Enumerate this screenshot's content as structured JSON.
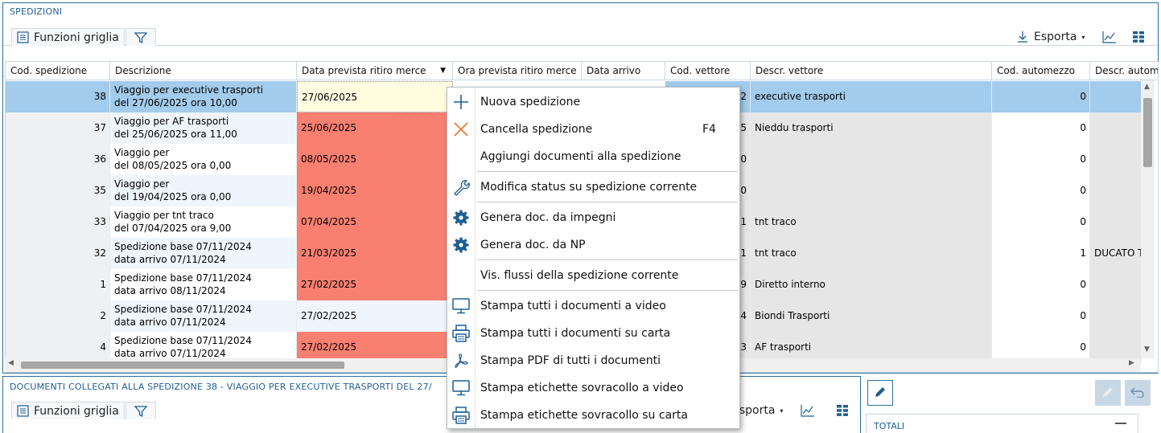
{
  "top_panel": {
    "title": "SPEDIZIONI",
    "toolbar": {
      "funzioni_griglia": "Funzioni griglia",
      "esporta": "Esporta"
    }
  },
  "grid": {
    "columns": [
      "Cod. spedizione",
      "Descrizione",
      "Data prevista ritiro merce",
      "Ora prevista ritiro merce",
      "Data arrivo",
      "Cod. vettore",
      "Descr. vettore",
      "Cod. automezzo",
      "Descr. autom"
    ],
    "rows": [
      {
        "cod": "38",
        "desc1": "Viaggio per executive trasporti",
        "desc2": "del 27/06/2025 ora 10,00",
        "data": "27/06/2025",
        "vett_cod": "2",
        "vett": "executive trasporti",
        "auto": "0",
        "auto_descr": ""
      },
      {
        "cod": "37",
        "desc1": "Viaggio per AF trasporti",
        "desc2": "del 25/06/2025 ora 11,00",
        "data": "25/06/2025",
        "vett_cod": "5",
        "vett": "Nieddu trasporti",
        "auto": "0",
        "auto_descr": ""
      },
      {
        "cod": "36",
        "desc1": "Viaggio per",
        "desc2": "del 08/05/2025 ora 0,00",
        "data": "08/05/2025",
        "vett_cod": "0",
        "vett": "",
        "auto": "0",
        "auto_descr": ""
      },
      {
        "cod": "35",
        "desc1": "Viaggio per",
        "desc2": "del 19/04/2025 ora 0,00",
        "data": "19/04/2025",
        "vett_cod": "0",
        "vett": "",
        "auto": "0",
        "auto_descr": ""
      },
      {
        "cod": "33",
        "desc1": "Viaggio per tnt traco",
        "desc2": "del 07/04/2025 ora 9,00",
        "data": "07/04/2025",
        "vett_cod": "1",
        "vett": "tnt traco",
        "auto": "0",
        "auto_descr": ""
      },
      {
        "cod": "32",
        "desc1": "Spedizione base 07/11/2024",
        "desc2": "data arrivo 07/11/2024",
        "data": "21/03/2025",
        "vett_cod": "1",
        "vett": "tnt traco",
        "auto": "1",
        "auto_descr": "DUCATO T"
      },
      {
        "cod": "1",
        "desc1": "Spedizione base 07/11/2024",
        "desc2": "data arrivo 08/11/2024",
        "data": "27/02/2025",
        "vett_cod": "9",
        "vett": "Diretto interno",
        "auto": "0",
        "auto_descr": ""
      },
      {
        "cod": "2",
        "desc1": "Spedizione base 07/11/2024",
        "desc2": "data arrivo 07/11/2024",
        "data": "27/02/2025",
        "vett_cod": "4",
        "vett": "Biondi Trasporti",
        "auto": "0",
        "auto_descr": ""
      },
      {
        "cod": "4",
        "desc1": "Spedizione base 07/11/2024",
        "desc2": "data arrivo 07/11/2024",
        "data": "27/02/2025",
        "vett_cod": "3",
        "vett": "AF trasporti",
        "auto": "0",
        "auto_descr": ""
      }
    ]
  },
  "context_menu": {
    "items": [
      {
        "label": "Nuova spedizione",
        "icon": "plus-icon",
        "shortcut": ""
      },
      {
        "label": "Cancella spedizione",
        "icon": "x-icon",
        "shortcut": "F4"
      },
      {
        "label": "Aggiungi documenti alla spedizione",
        "icon": "",
        "shortcut": ""
      },
      {
        "label": "Modifica status su spedizione corrente",
        "icon": "wrench-icon",
        "shortcut": ""
      },
      {
        "label": "Genera doc. da impegni",
        "icon": "gear-icon",
        "shortcut": ""
      },
      {
        "label": "Genera doc. da NP",
        "icon": "gear-icon",
        "shortcut": ""
      },
      {
        "label": "Vis. flussi della spedizione corrente",
        "icon": "",
        "shortcut": ""
      },
      {
        "label": "Stampa tutti i documenti a video",
        "icon": "monitor-icon",
        "shortcut": ""
      },
      {
        "label": "Stampa tutti i documenti su carta",
        "icon": "printer-icon",
        "shortcut": ""
      },
      {
        "label": "Stampa PDF di tutti i documenti",
        "icon": "pdf-icon",
        "shortcut": ""
      },
      {
        "label": "Stampa etichette sovracollo a video",
        "icon": "monitor-icon",
        "shortcut": ""
      },
      {
        "label": "Stampa etichette sovracollo su carta",
        "icon": "printer-icon",
        "shortcut": ""
      }
    ]
  },
  "bottom_panel": {
    "title": "DOCUMENTI COLLEGATI ALLA SPEDIZIONE 38 - VIAGGIO PER EXECUTIVE TRASPORTI  DEL 27/",
    "toolbar": {
      "funzioni_griglia": "Funzioni griglia",
      "esporta": "Esporta"
    }
  },
  "totali": {
    "title": "TOTALI"
  },
  "colors": {
    "accent": "#2b6f9e",
    "selected_row": "#a3cbeb",
    "overdue": "#f98071",
    "icon_blue": "#1f5e92",
    "cancel_orange": "#e8762d"
  }
}
